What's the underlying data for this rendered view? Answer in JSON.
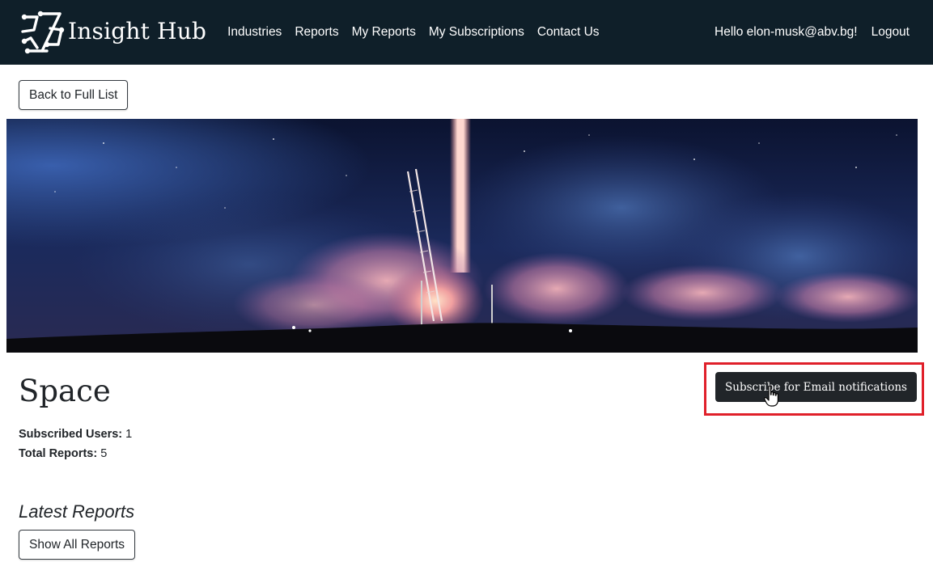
{
  "navbar": {
    "brand": "Insight Hub",
    "logo_icon": "puzzle-network-logo",
    "links": [
      "Industries",
      "Reports",
      "My Reports",
      "My Subscriptions",
      "Contact Us"
    ],
    "greeting": "Hello elon-musk@abv.bg!",
    "logout": "Logout",
    "background": "#0f1f29"
  },
  "back_button": "Back to Full List",
  "banner": {
    "description_icon": "rocket-launch-image"
  },
  "industry": {
    "title": "Space",
    "subscribed_label": "Subscribed Users:",
    "subscribed_value": "1",
    "reports_label": "Total Reports:",
    "reports_value": "5"
  },
  "subscribe_button": "Subscribe for Email notifications",
  "latest_reports": {
    "heading": "Latest Reports",
    "show_all": "Show All Reports"
  },
  "colors": {
    "highlight": "#e0202a",
    "dark_button": "#212529"
  }
}
